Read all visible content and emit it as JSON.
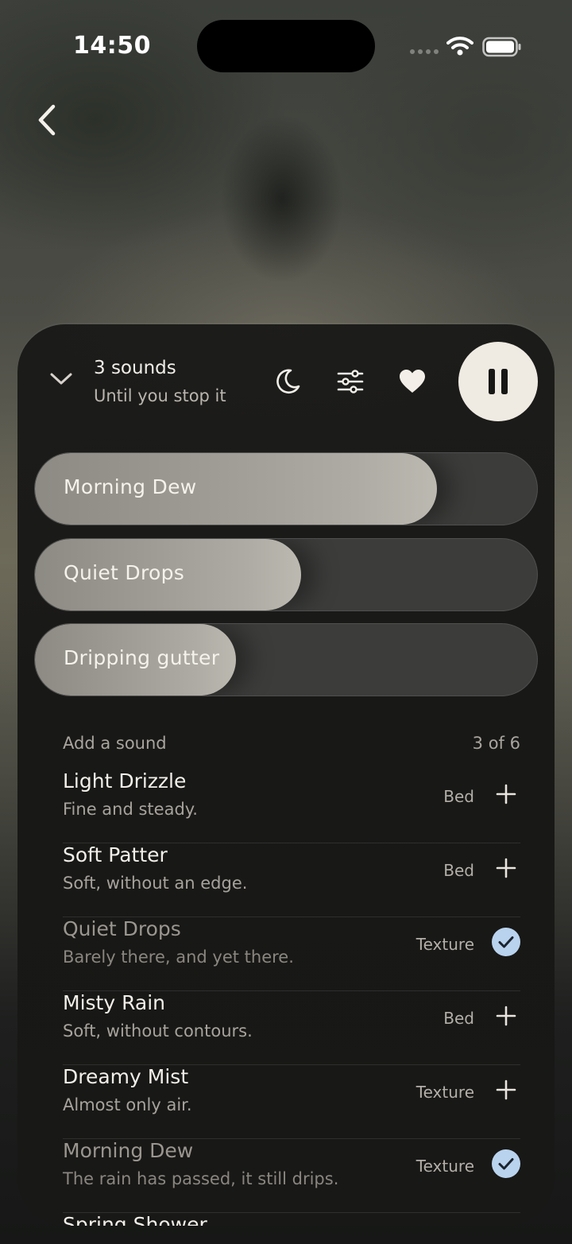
{
  "status_bar": {
    "time": "14:50"
  },
  "mix": {
    "title": "3 sounds",
    "subtitle": "Until you stop it"
  },
  "active_sounds": [
    {
      "label": "Morning Dew",
      "level": 0.8
    },
    {
      "label": "Quiet Drops",
      "level": 0.53
    },
    {
      "label": "Dripping gutter",
      "level": 0.4
    }
  ],
  "add_section": {
    "title": "Add a sound",
    "count": "3 of 6"
  },
  "sound_list": [
    {
      "name": "Light Drizzle",
      "desc": "Fine and steady.",
      "tag": "Bed",
      "added": false
    },
    {
      "name": "Soft Patter",
      "desc": "Soft, without an edge.",
      "tag": "Bed",
      "added": false
    },
    {
      "name": "Quiet Drops",
      "desc": "Barely there, and yet there.",
      "tag": "Texture",
      "added": true
    },
    {
      "name": "Misty Rain",
      "desc": "Soft, without contours.",
      "tag": "Bed",
      "added": false
    },
    {
      "name": "Dreamy Mist",
      "desc": "Almost only air.",
      "tag": "Texture",
      "added": false
    },
    {
      "name": "Morning Dew",
      "desc": "The rain has passed, it still drips.",
      "tag": "Texture",
      "added": true
    },
    {
      "name": "Spring Shower",
      "desc": "",
      "tag": "",
      "added": false
    }
  ],
  "colors": {
    "accent_check": "#b9d3ee",
    "play_button": "#efeae2",
    "sheet": "#171716"
  },
  "icons": [
    "back-icon",
    "chevron-down-icon",
    "moon-icon",
    "sliders-icon",
    "heart-icon",
    "pause-icon",
    "plus-icon",
    "check-icon",
    "wifi-icon",
    "battery-icon"
  ]
}
